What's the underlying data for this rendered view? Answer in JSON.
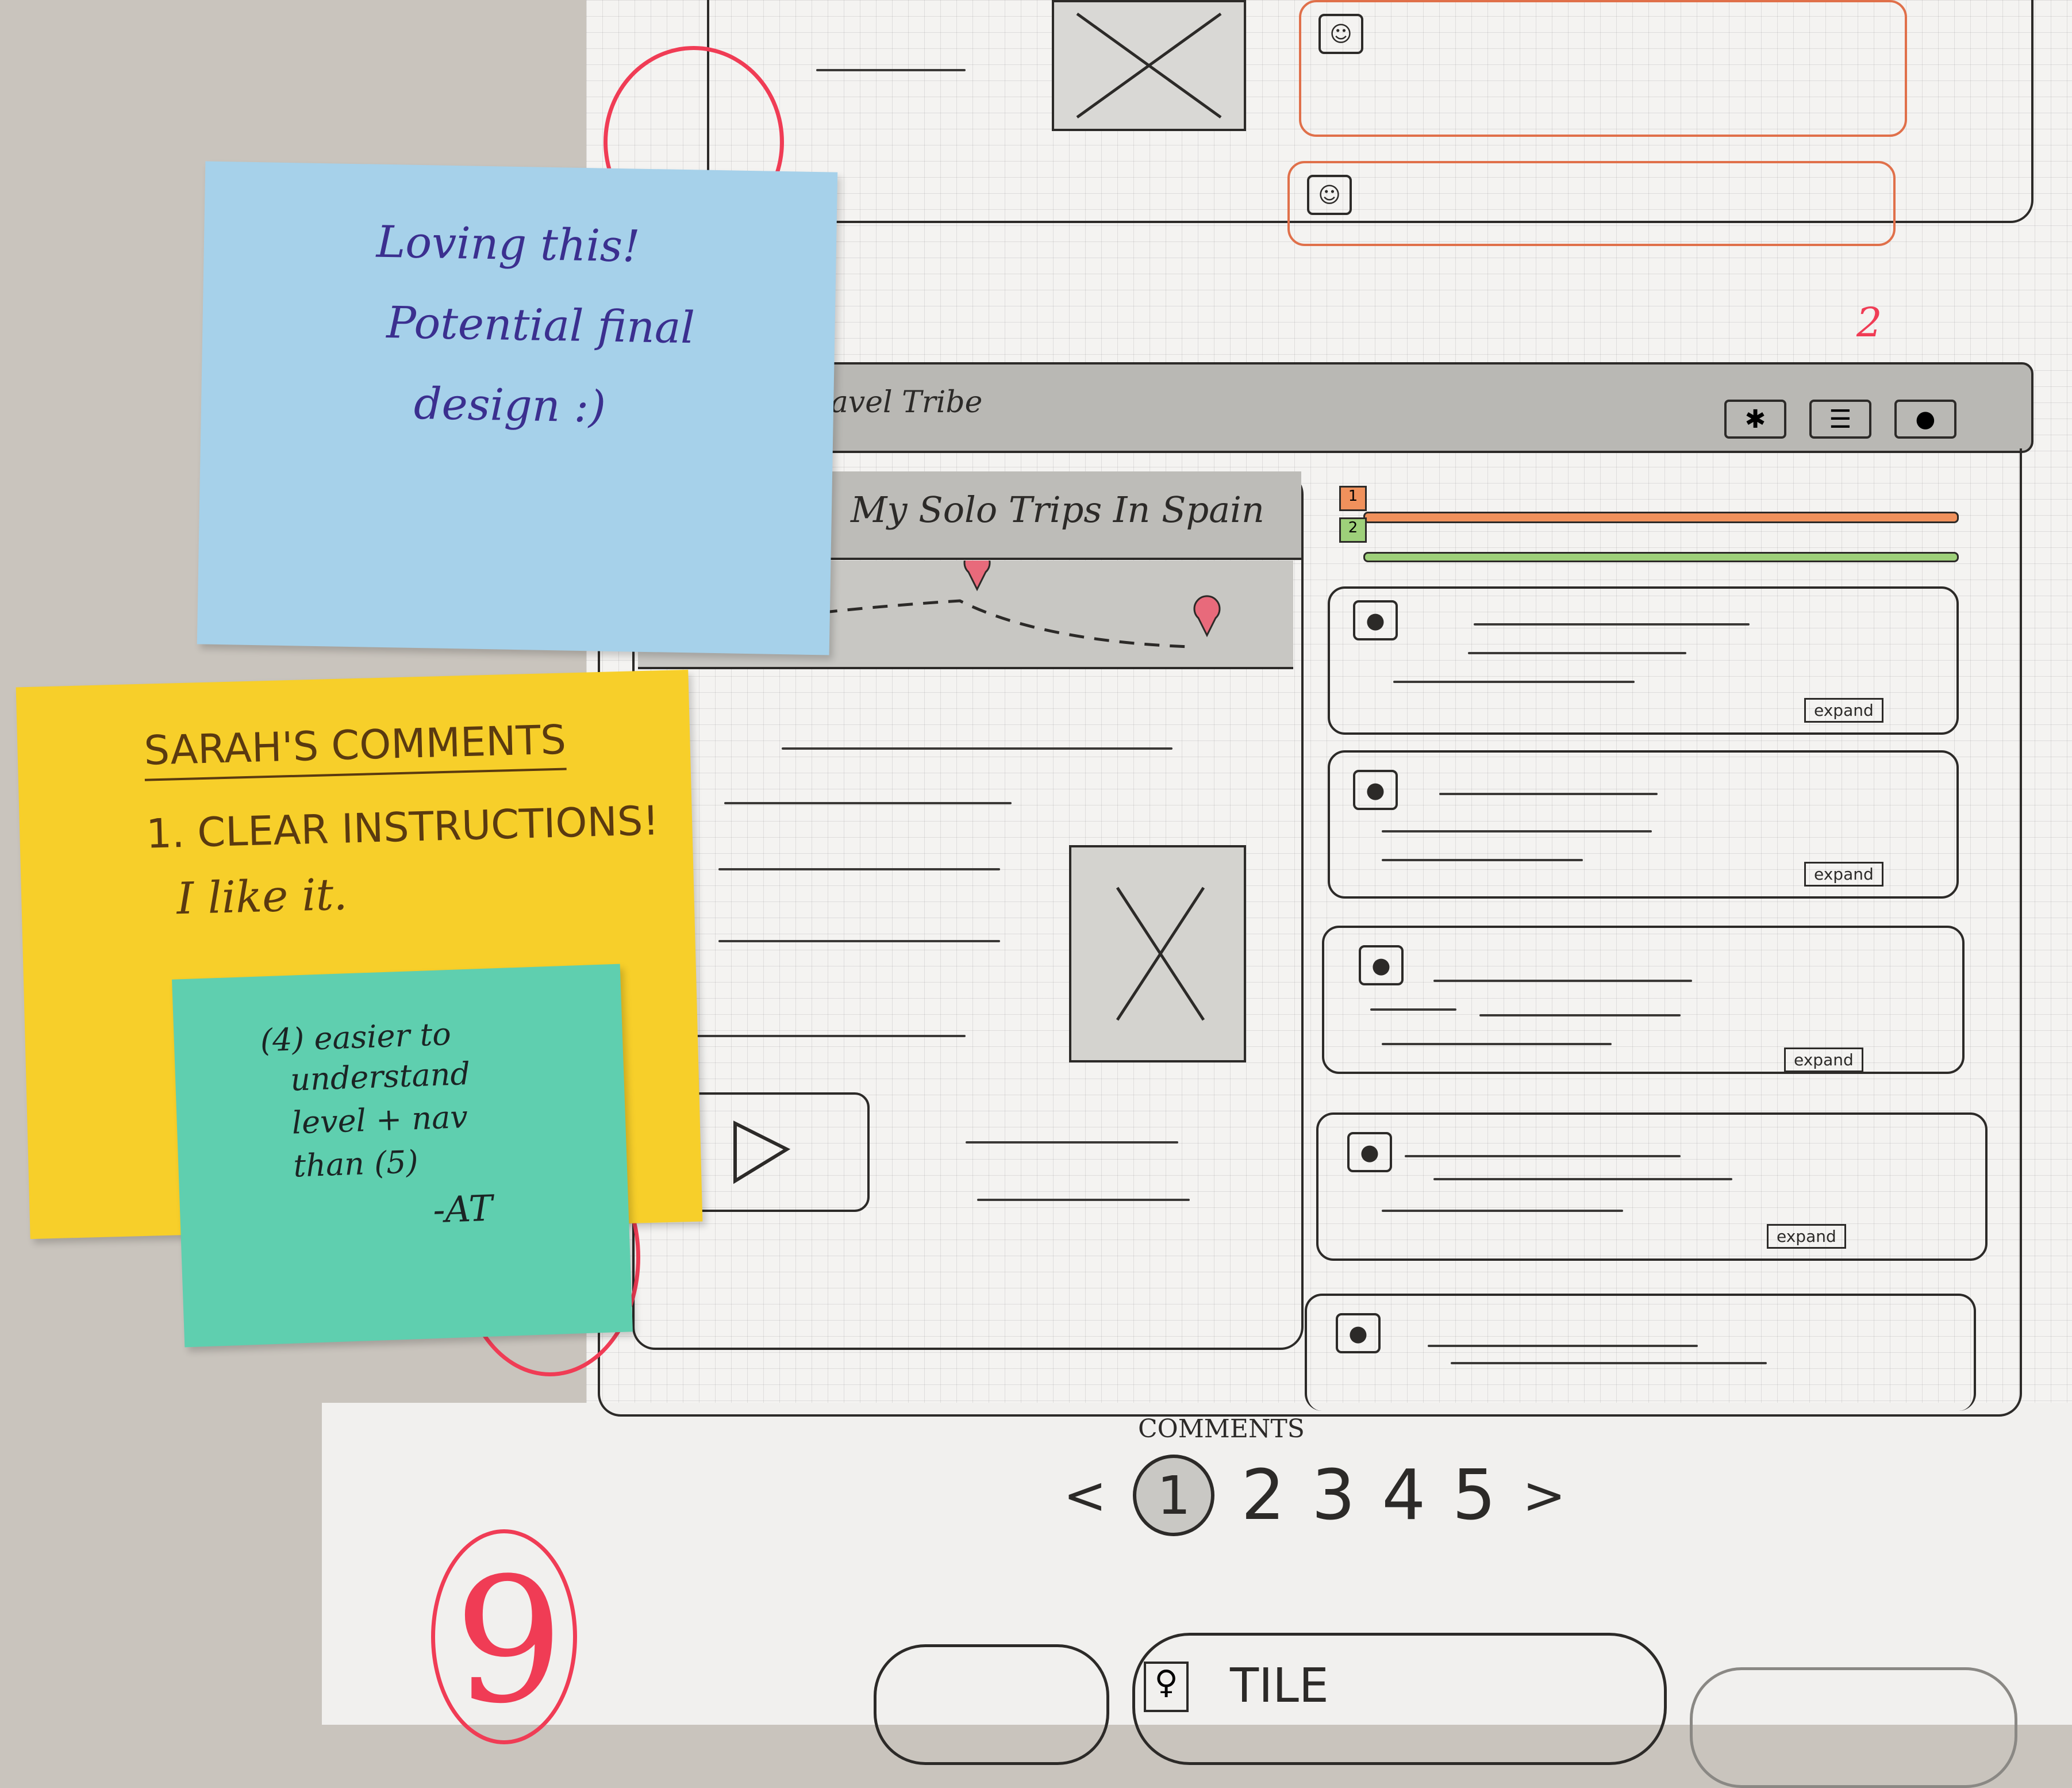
{
  "sketch": {
    "app_name": "ravel Tribe",
    "trip_title": "My Solo Trips In Spain",
    "level_numbers": [
      "1",
      "2"
    ],
    "expand_label": "expand",
    "comments_label": "COMMENTS",
    "pages": [
      "<",
      "1",
      "2",
      "3",
      "4",
      "5",
      ">"
    ],
    "tile_label": "TILE",
    "page_number": "2",
    "bottom_number": "9"
  },
  "notes": {
    "blue": {
      "lines": [
        "Loving this!",
        "Potential final",
        "design :)"
      ]
    },
    "yellow": {
      "heading": "SARAH'S COMMENTS",
      "lines": [
        "1. CLEAR INSTRUCTIONS!",
        "I like it."
      ]
    },
    "teal": {
      "lines": [
        "(4) easier to",
        "understand",
        "level + nav",
        "than (5)"
      ],
      "signature": "-AT"
    }
  },
  "colors": {
    "blue_note": "#a6d1ea",
    "yellow_note": "#f7cf2a",
    "teal_note": "#5fcfaf",
    "red_marker": "#f03c55",
    "orange_bar": "#f0915c",
    "green_bar": "#9ed07a"
  }
}
